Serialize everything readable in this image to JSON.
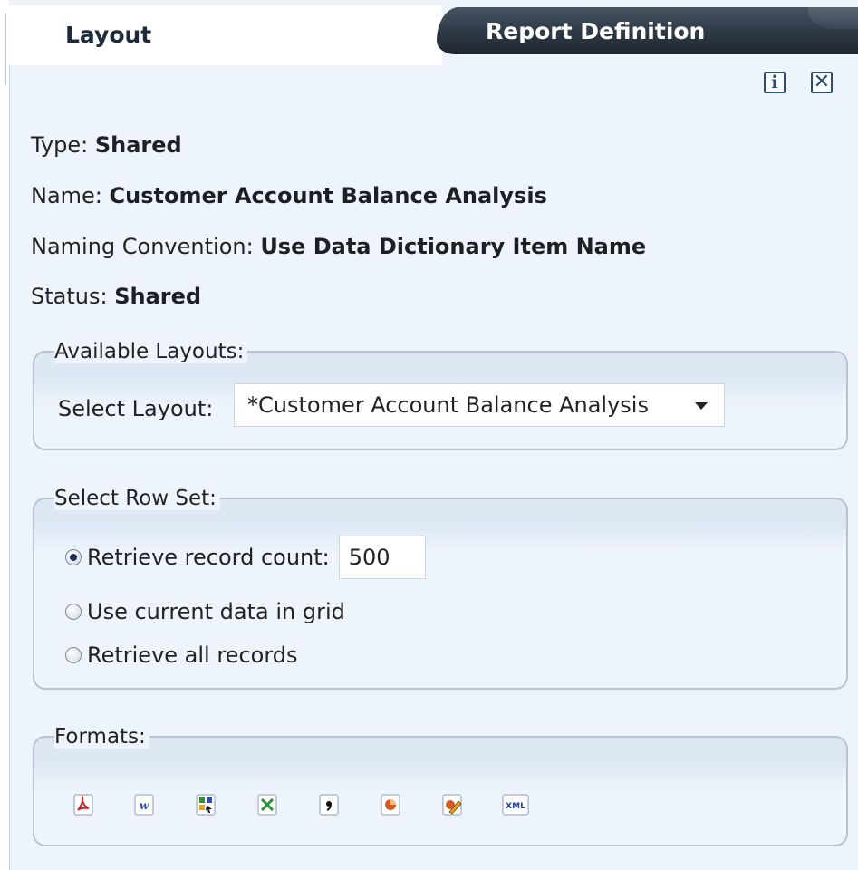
{
  "tabs": {
    "active": "Layout",
    "inactive": "Report Definition"
  },
  "header_icons": [
    "info-icon",
    "close-icon"
  ],
  "header_icon_glyphs": {
    "info": "i",
    "close": "✕"
  },
  "details": {
    "type_label": "Type:",
    "type_value": "Shared",
    "name_label": "Name:",
    "name_value": "Customer Account Balance Analysis",
    "naming_label": "Naming Convention:",
    "naming_value": "Use Data Dictionary Item Name",
    "status_label": "Status:",
    "status_value": "Shared"
  },
  "available_layouts": {
    "legend": "Available Layouts:",
    "select_label": "Select Layout:",
    "selected": "*Customer Account Balance Analysis"
  },
  "row_set": {
    "legend": "Select Row Set:",
    "options": [
      {
        "label": "Retrieve record count:",
        "checked": true
      },
      {
        "label": "Use current data in grid",
        "checked": false
      },
      {
        "label": "Retrieve all records",
        "checked": false
      }
    ],
    "record_count": "500"
  },
  "formats": {
    "legend": "Formats:",
    "icons": [
      "pdf-icon",
      "word-icon",
      "one-view-layout-icon",
      "excel-icon",
      "csv-icon",
      "powerpoint-icon",
      "edit-template-icon",
      "xml-icon"
    ]
  },
  "colors": {
    "panel_bg": "#eef4fb",
    "tab_inactive_bg": "#2d3845",
    "pdf_red": "#c9262b",
    "word_blue": "#2b4f9e",
    "excel_green": "#2f8f3a",
    "ppt_orange": "#d35a20",
    "xml_blue": "#1d3fa0"
  }
}
